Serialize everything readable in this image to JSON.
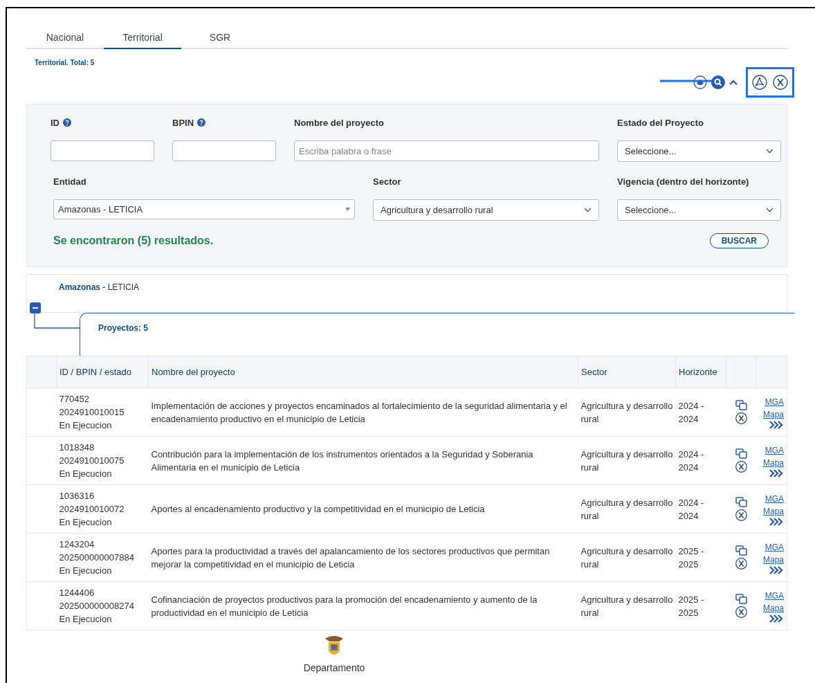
{
  "tabs": [
    {
      "label": "Nacional",
      "selected": false
    },
    {
      "label": "Territorial",
      "selected": true
    },
    {
      "label": "SGR",
      "selected": false
    }
  ],
  "total_label": "Territorial. Total: 5",
  "filters": {
    "fields": [
      {
        "kind": "text",
        "label": "ID",
        "help": true
      },
      {
        "kind": "text",
        "label": "BPIN",
        "help": true
      },
      {
        "kind": "text",
        "label": "Nombre del proyecto",
        "placeholder": "Escriba palabra o frase"
      },
      {
        "kind": "select",
        "label": "Estado del Proyecto",
        "value": "Seleccione..."
      },
      {
        "kind": "combo",
        "label": "Entidad",
        "value": "Amazonas - LETICIA"
      },
      {
        "kind": "select",
        "label": "Sector",
        "value": "Agricultura y desarrollo rural"
      },
      {
        "kind": "select",
        "label": "Vigencia (dentro del horizonte)",
        "value": "Seleccione..."
      }
    ],
    "result_message": "Se encontraron (5) resultados.",
    "search_button": "BUSCAR"
  },
  "group": {
    "department": "Amazonas -",
    "municipality": "LETICIA",
    "expanded": true,
    "projects_label": "Proyectos: 5"
  },
  "table": {
    "columns": [
      "ID / BPIN / estado",
      "Nombre del proyecto",
      "Sector",
      "Horizonte"
    ],
    "rows": [
      {
        "id": "770452",
        "bpin": "2024910010015",
        "estado": "En Ejecucion",
        "nombre": "Implementación de acciones y proyectos encaminados al fortalecimiento de la seguridad alimentaria y el encadenamiento productivo en el municipio de Leticia",
        "sector": "Agricultura y desarrollo rural",
        "horizonte": "2024 - 2024",
        "links": [
          "MGA",
          "Mapa"
        ]
      },
      {
        "id": "1018348",
        "bpin": "2024910010075",
        "estado": "En Ejecucion",
        "nombre": "Contribución para la implementación de los instrumentos orientados a la Seguridad y Soberania Alimentaria en el municipio de Leticia",
        "sector": "Agricultura y desarrollo rural",
        "horizonte": "2024 - 2024",
        "links": [
          "MGA",
          "Mapa"
        ]
      },
      {
        "id": "1036316",
        "bpin": "2024910010072",
        "estado": "En Ejecucion",
        "nombre": "Aportes al encadenamiento productivo y la competitividad en el municipio de Leticia",
        "sector": "Agricultura y desarrollo rural",
        "horizonte": "2024 - 2024",
        "links": [
          "MGA",
          "Mapa"
        ]
      },
      {
        "id": "1243204",
        "bpin": "202500000007884",
        "estado": "En Ejecucion",
        "nombre": "Aportes para la productividad a través del apalancamiento de los sectores productivos que permitan mejorar la competitividad en el municipio de Leticia",
        "sector": "Agricultura y desarrollo rural",
        "horizonte": "2025 - 2025",
        "links": [
          "MGA",
          "Mapa"
        ]
      },
      {
        "id": "1244406",
        "bpin": "202500000008274",
        "estado": "En Ejecucion",
        "nombre": "Cofinanciación de proyectos productivos para la promoción del encadenamiento y aumento de la productividad en el municipio de Leticia",
        "sector": "Agricultura y desarrollo rural",
        "horizonte": "2025 - 2025",
        "links": [
          "MGA",
          "Mapa"
        ]
      }
    ]
  },
  "footer": {
    "label": "Departamento"
  }
}
